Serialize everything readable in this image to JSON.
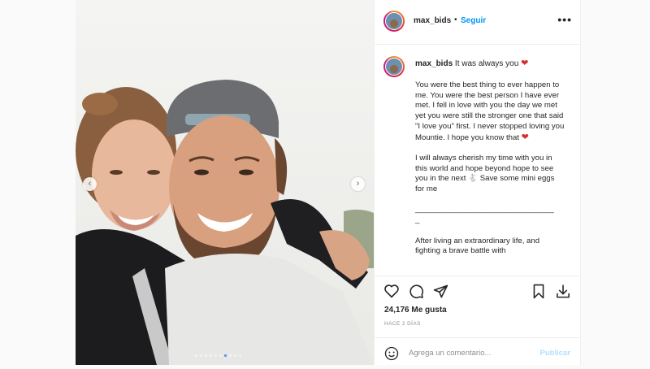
{
  "post": {
    "username": "max_bids",
    "dot": "•",
    "follow_label": "Seguir",
    "more_label": "•••",
    "caption": {
      "username": "max_bids",
      "first_line": "It was always you",
      "heart": "❤",
      "paragraphs": [
        "You were the best thing to ever happen to me. You were the best person I have ever met. I fell in love with you the day we met yet you were still the stronger one that said \"I love you\" first. I never stopped loving you Mountie. I hope you know that",
        "I will always cherish my time with you in this world and hope beyond hope to see you in the next",
        "Save some mini eggs for me",
        "________________________________",
        "After living an extraordinary life, and fighting a brave battle with"
      ],
      "rabbit_icon": "🐇"
    },
    "likes_text": "24,176 Me gusta",
    "time_ago": "HACE 2 DÍAS",
    "comment_placeholder": "Agrega un comentario...",
    "publish_label": "Publicar",
    "icons": [
      "heart-icon",
      "comment-icon",
      "share-icon",
      "bookmark-icon",
      "download-icon",
      "emoji-icon",
      "prev-icon",
      "next-icon"
    ]
  },
  "carousel": {
    "count": 10,
    "active": 6
  },
  "colors": {
    "link": "#0095f6",
    "heart": "#d62d2d",
    "publish_disabled": "#b2dffc",
    "dot_active": "#3897f0"
  }
}
